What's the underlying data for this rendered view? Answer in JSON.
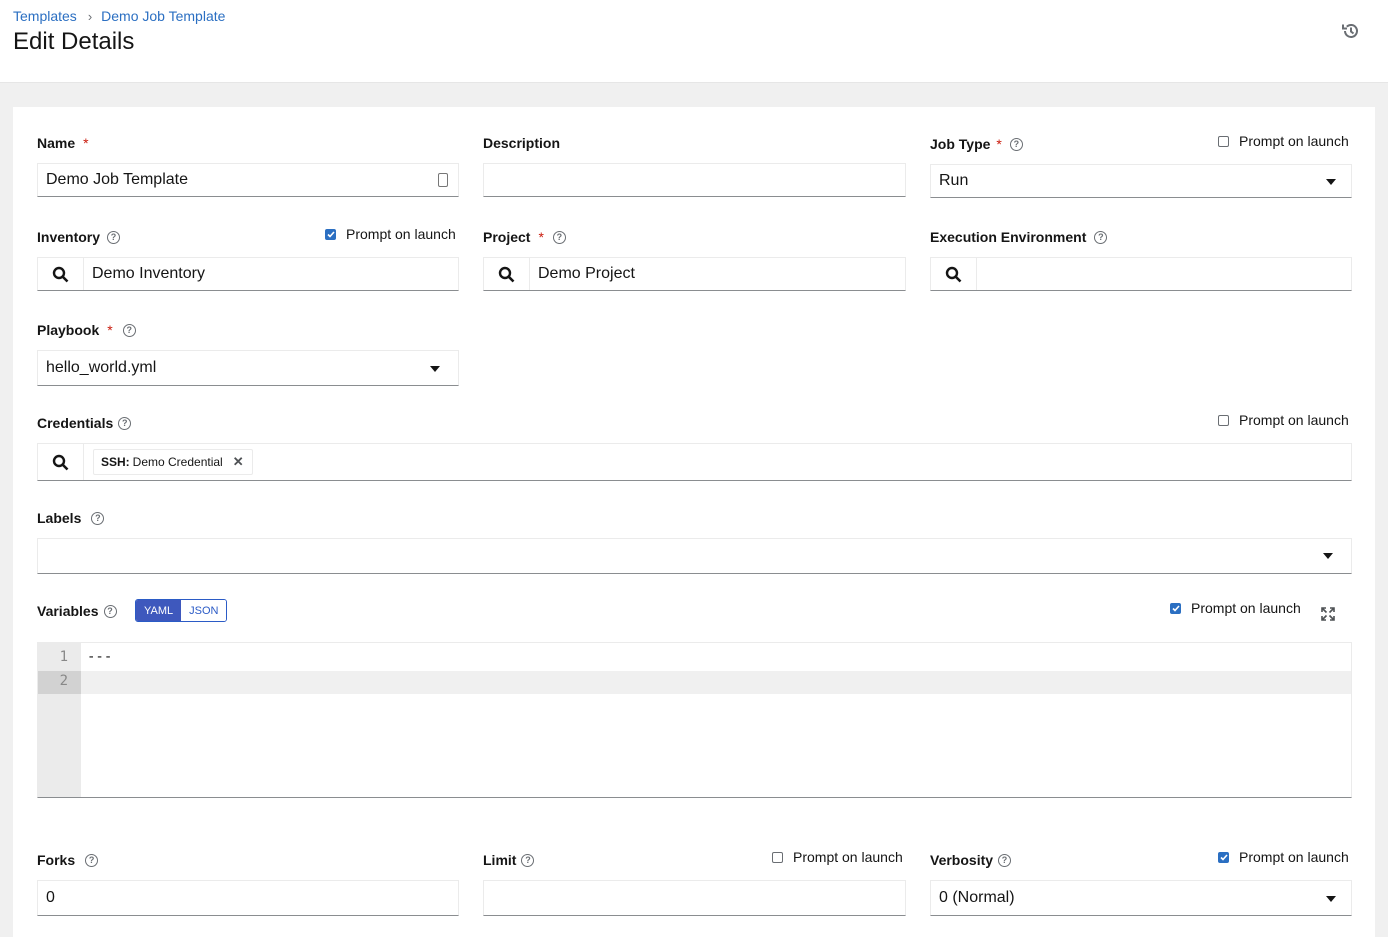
{
  "breadcrumb": {
    "items": [
      "Templates",
      "Demo Job Template"
    ],
    "separator": "›"
  },
  "page_title": "Edit Details",
  "header": {
    "history_icon": "history-icon"
  },
  "prompt_label": "Prompt on launch",
  "fields": {
    "name": {
      "label": "Name",
      "required": "*",
      "value": "Demo Job Template"
    },
    "description": {
      "label": "Description",
      "value": ""
    },
    "job_type": {
      "label": "Job Type",
      "required": "*",
      "value": "Run",
      "prompt_on_launch": false
    },
    "inventory": {
      "label": "Inventory",
      "value": "Demo Inventory",
      "prompt_on_launch": true
    },
    "project": {
      "label": "Project",
      "required": "*",
      "value": "Demo Project"
    },
    "execution_environment": {
      "label": "Execution Environment",
      "value": ""
    },
    "playbook": {
      "label": "Playbook",
      "required": "*",
      "value": "hello_world.yml"
    },
    "credentials": {
      "label": "Credentials",
      "prompt_on_launch": false,
      "chips": [
        {
          "type": "SSH:",
          "name": "Demo Credential"
        }
      ]
    },
    "labels": {
      "label": "Labels",
      "value": ""
    },
    "variables": {
      "label": "Variables",
      "modes": [
        "YAML",
        "JSON"
      ],
      "active_mode": "YAML",
      "prompt_on_launch": true,
      "line_numbers": [
        "1",
        "2"
      ],
      "lines": [
        "---",
        ""
      ]
    },
    "forks": {
      "label": "Forks",
      "value": "0"
    },
    "limit": {
      "label": "Limit",
      "value": "",
      "prompt_on_launch": false
    },
    "verbosity": {
      "label": "Verbosity",
      "value": "0 (Normal)",
      "prompt_on_launch": true
    }
  },
  "colors": {
    "accent": "#2b6fc2",
    "required": "#c9190b",
    "toggle_active": "#3e58bd"
  }
}
